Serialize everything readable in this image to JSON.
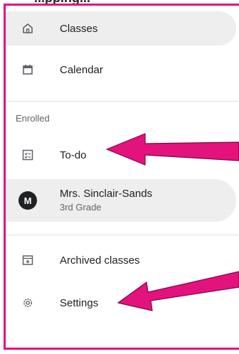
{
  "header": {
    "caption": "...pping..."
  },
  "nav": {
    "classes_label": "Classes",
    "calendar_label": "Calendar"
  },
  "enrolled": {
    "section_label": "Enrolled",
    "todo_label": "To-do",
    "class": {
      "avatar_letter": "M",
      "name": "Mrs. Sinclair-Sands",
      "subtitle": "3rd Grade"
    }
  },
  "footer_nav": {
    "archived_label": "Archived classes",
    "settings_label": "Settings"
  },
  "colors": {
    "annotation_magenta": "#e4127c",
    "selected_background": "#eeeeee",
    "avatar_background": "#202124"
  }
}
